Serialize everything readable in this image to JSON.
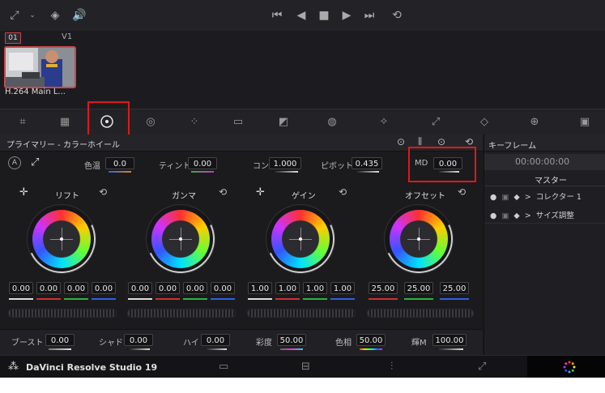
{
  "app": {
    "name": "DaVinci Resolve Studio 19"
  },
  "clip": {
    "number": "01",
    "track": "V1",
    "name": "H.264 Main L..."
  },
  "panel": {
    "title": "プライマリー - カラーホイール"
  },
  "adjust": {
    "auto_label": "A",
    "temp": {
      "label": "色温",
      "value": "0.0"
    },
    "tint": {
      "label": "ティント",
      "value": "0.00"
    },
    "contrast": {
      "label": "コン",
      "value": "1.000"
    },
    "pivot": {
      "label": "ピボット",
      "value": "0.435"
    },
    "md": {
      "label": "MD",
      "value": "0.00"
    }
  },
  "wheels": [
    {
      "name": "リフト",
      "values": [
        "0.00",
        "0.00",
        "0.00",
        "0.00"
      ]
    },
    {
      "name": "ガンマ",
      "values": [
        "0.00",
        "0.00",
        "0.00",
        "0.00"
      ]
    },
    {
      "name": "ゲイン",
      "values": [
        "1.00",
        "1.00",
        "1.00",
        "1.00"
      ]
    },
    {
      "name": "オフセット",
      "values": [
        "25.00",
        "25.00",
        "25.00"
      ]
    }
  ],
  "bottom": {
    "boost": {
      "label": "ブースト",
      "value": "0.00"
    },
    "shadow": {
      "label": "シャド",
      "value": "0.00"
    },
    "high": {
      "label": "ハイ",
      "value": "0.00"
    },
    "sat": {
      "label": "彩度",
      "value": "50.00"
    },
    "hue": {
      "label": "色相",
      "value": "50.00"
    },
    "lum": {
      "label": "輝M",
      "value": "100.00"
    }
  },
  "keyframes": {
    "title": "キーフレーム",
    "timecode": "00:00:00:00",
    "master": "マスター",
    "items": [
      "コレクター 1",
      "サイズ調整"
    ]
  },
  "colors": {
    "highlight": "#e01818",
    "red": "#d03030",
    "green": "#30b040",
    "blue": "#3060e0",
    "accent_orange": "#e08020"
  }
}
